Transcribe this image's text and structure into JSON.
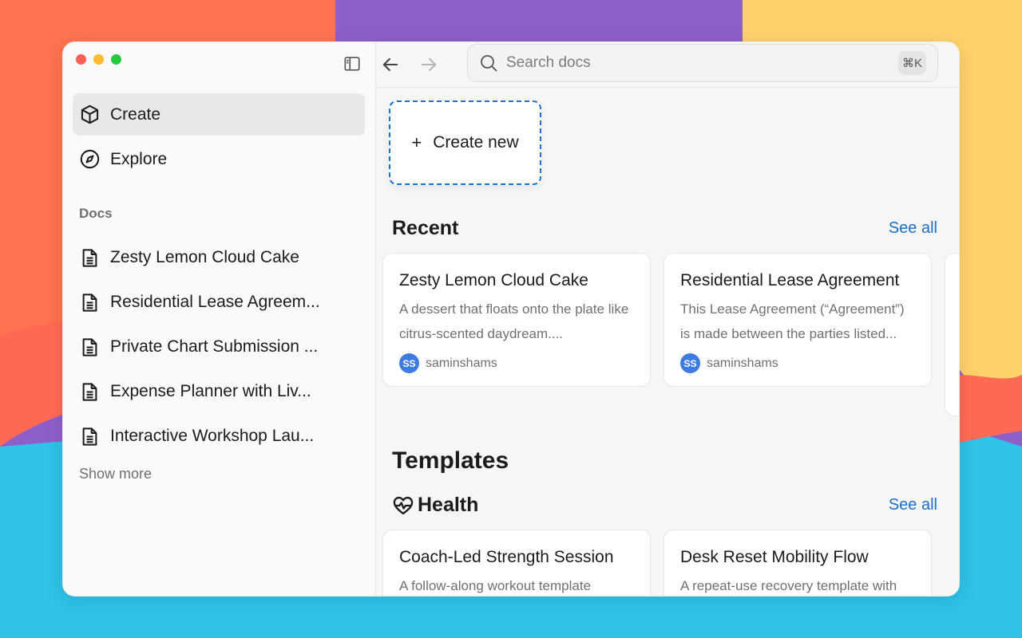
{
  "window": {
    "traffic_lights": [
      "close",
      "minimize",
      "zoom"
    ]
  },
  "sidebar": {
    "nav": [
      {
        "label": "Create",
        "icon": "cube-icon",
        "active": true
      },
      {
        "label": "Explore",
        "icon": "compass-icon",
        "active": false
      }
    ],
    "docs_label": "Docs",
    "docs": [
      {
        "label": "Zesty Lemon Cloud Cake"
      },
      {
        "label": "Residential Lease Agreem..."
      },
      {
        "label": "Private Chart Submission ..."
      },
      {
        "label": "Expense Planner with Liv..."
      },
      {
        "label": "Interactive Workshop Lau..."
      }
    ],
    "show_more": "Show more"
  },
  "topbar": {
    "search_placeholder": "Search docs",
    "shortcut": "⌘K"
  },
  "main": {
    "create_new": {
      "plus": "+",
      "label": "Create new"
    },
    "recent": {
      "title": "Recent",
      "see_all": "See all",
      "cards": [
        {
          "title": "Zesty Lemon Cloud Cake",
          "desc": "A dessert that floats onto the plate like citrus-scented daydream....",
          "avatar": "SS",
          "author": "saminshams"
        },
        {
          "title": "Residential Lease Agreement",
          "desc": "This Lease Agreement (“Agreement”) is made between the parties listed...",
          "avatar": "SS",
          "author": "saminshams"
        }
      ]
    },
    "templates": {
      "title": "Templates",
      "category": "Health",
      "see_all": "See all",
      "cards": [
        {
          "title": "Coach-Led Strength Session",
          "desc": "A follow-along workout template"
        },
        {
          "title": "Desk Reset Mobility Flow",
          "desc": "A repeat-use recovery template with"
        }
      ]
    }
  },
  "colors": {
    "accent": "#1c6fc6",
    "active_nav_bg": "#e9e8e6",
    "avatar_bg": "#3d7be0"
  }
}
